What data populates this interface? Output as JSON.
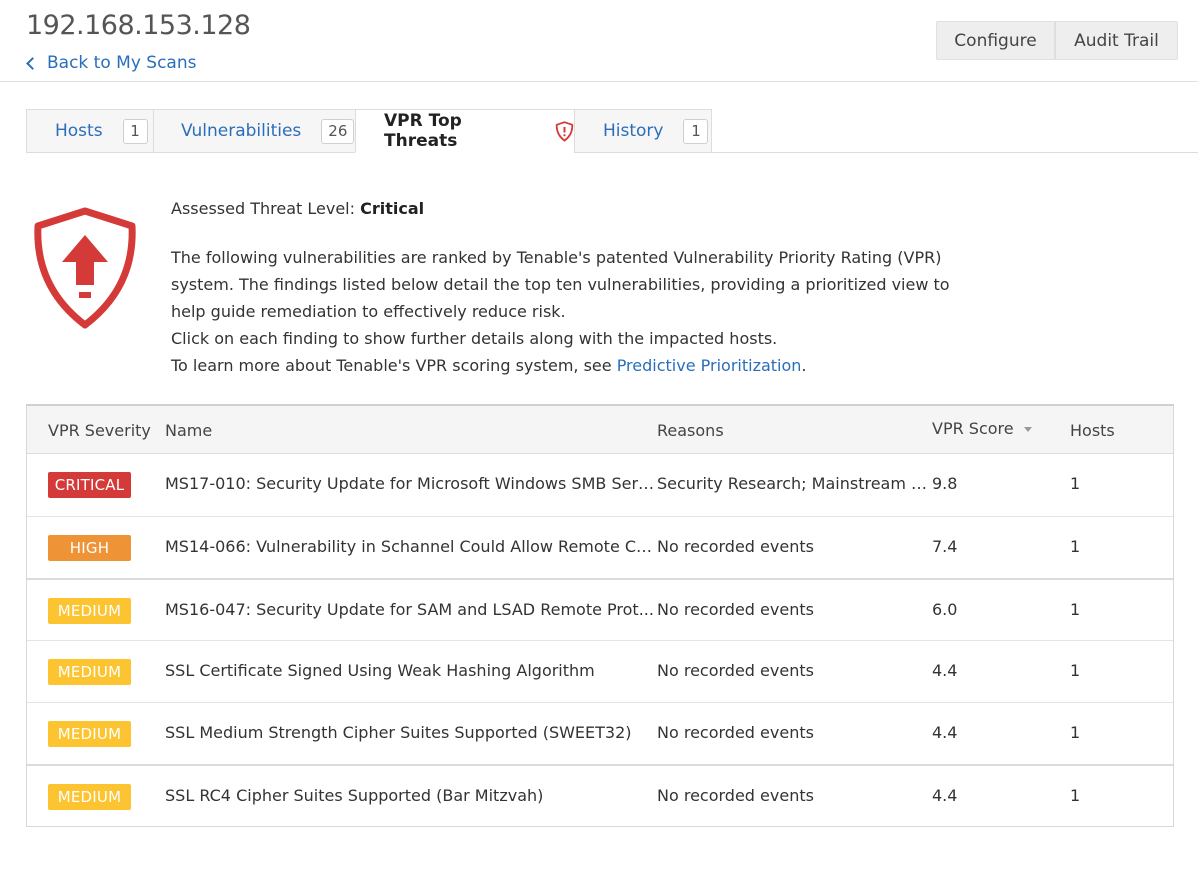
{
  "header": {
    "title": "192.168.153.128",
    "back_label": "Back to My Scans",
    "configure_label": "Configure",
    "audit_label": "Audit Trail"
  },
  "tabs": [
    {
      "label": "Hosts",
      "count": "1"
    },
    {
      "label": "Vulnerabilities",
      "count": "26"
    },
    {
      "label": "VPR Top Threats",
      "icon": "shield-alert-icon"
    },
    {
      "label": "History",
      "count": "1"
    }
  ],
  "summary": {
    "threat_label": "Assessed Threat Level:",
    "threat_value": "Critical",
    "desc_1": "The following vulnerabilities are ranked by Tenable's patented Vulnerability Priority Rating (VPR) system. The findings listed below detail the top ten vulnerabilities, providing a prioritized view to help guide remediation to effectively reduce risk.",
    "desc_2": "Click on each finding to show further details along with the impacted hosts.",
    "desc_3_prefix": "To learn more about Tenable's VPR scoring system, see ",
    "desc_3_link": "Predictive Prioritization",
    "desc_3_suffix": "."
  },
  "table": {
    "columns": {
      "severity": "VPR Severity",
      "name": "Name",
      "reasons": "Reasons",
      "score": "VPR Score",
      "hosts": "Hosts"
    },
    "rows": [
      {
        "severity": "CRITICAL",
        "name": "MS17-010: Security Update for Microsoft Windows SMB Serv...",
        "reasons": "Security Research; Mainstream M...",
        "score": "9.8",
        "hosts": "1"
      },
      {
        "severity": "HIGH",
        "name": "MS14-066: Vulnerability in Schannel Could Allow Remote Co...",
        "reasons": "No recorded events",
        "score": "7.4",
        "hosts": "1"
      },
      {
        "severity": "MEDIUM",
        "name": "MS16-047: Security Update for SAM and LSAD Remote Prot...",
        "reasons": "No recorded events",
        "score": "6.0",
        "hosts": "1"
      },
      {
        "severity": "MEDIUM",
        "name": "SSL Certificate Signed Using Weak Hashing Algorithm",
        "reasons": "No recorded events",
        "score": "4.4",
        "hosts": "1"
      },
      {
        "severity": "MEDIUM",
        "name": "SSL Medium Strength Cipher Suites Supported (SWEET32)",
        "reasons": "No recorded events",
        "score": "4.4",
        "hosts": "1"
      },
      {
        "severity": "MEDIUM",
        "name": "SSL RC4 Cipher Suites Supported (Bar Mitzvah)",
        "reasons": "No recorded events",
        "score": "4.4",
        "hosts": "1"
      }
    ]
  },
  "colors": {
    "critical": "#d43a38",
    "high": "#ee9336",
    "medium": "#fdc431",
    "link": "#2a6ebb"
  }
}
